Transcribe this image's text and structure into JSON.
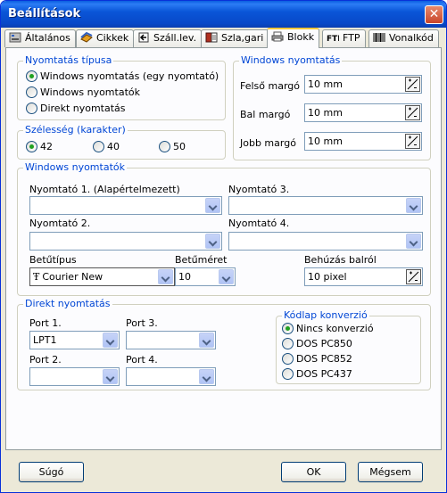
{
  "window": {
    "title": "Beállítások",
    "close_glyph": "✕"
  },
  "tabs": [
    {
      "label": "Általános",
      "icon": "settings-icon",
      "active": false
    },
    {
      "label": "Cikkek",
      "icon": "items-icon",
      "active": false
    },
    {
      "label": "Száll.lev.",
      "icon": "delivery-note-icon",
      "active": false
    },
    {
      "label": "Szla,gari",
      "icon": "invoice-icon",
      "active": false
    },
    {
      "label": "Blokk",
      "icon": "printer-icon",
      "active": true
    },
    {
      "label": "FTP",
      "icon": "ftp-icon",
      "active": false
    },
    {
      "label": "Vonalkód",
      "icon": "barcode-icon",
      "active": false
    }
  ],
  "print_type": {
    "legend": "Nyomtatás típusa",
    "options": [
      "Windows nyomtatás (egy nyomtató)",
      "Windows nyomtatók",
      "Direkt nyomtatás"
    ],
    "selected": 0
  },
  "width": {
    "legend": "Szélesség (karakter)",
    "options": [
      "42",
      "40",
      "50"
    ],
    "selected": 0
  },
  "windows_print": {
    "legend": "Windows nyomtatás",
    "fields": [
      {
        "label": "Felső margó",
        "value": "10 mm"
      },
      {
        "label": "Bal margó",
        "value": "10 mm"
      },
      {
        "label": "Jobb margó",
        "value": "10 mm"
      }
    ]
  },
  "windows_printers": {
    "legend": "Windows nyomtatók",
    "printer1_label": "Nyomtató 1. (Alapértelmezett)",
    "printer2_label": "Nyomtató 2.",
    "printer3_label": "Nyomtató 3.",
    "printer4_label": "Nyomtató 4.",
    "font_label": "Betűtípus",
    "font_value": "Courier New",
    "font_icon_glyph": "Ŧ",
    "fontsize_label": "Betűméret",
    "fontsize_value": "10",
    "indent_label": "Behúzás balról",
    "indent_value": "10 pixel"
  },
  "direct_print": {
    "legend": "Direkt nyomtatás",
    "port1_label": "Port 1.",
    "port1_value": "LPT1",
    "port2_label": "Port 2.",
    "port3_label": "Port 3.",
    "port4_label": "Port 4."
  },
  "codepage": {
    "legend": "Kódlap konverzió",
    "options": [
      "Nincs konverzió",
      "DOS PC850",
      "DOS PC852",
      "DOS PC437"
    ],
    "selected": 0
  },
  "buttons": {
    "help": "Súgó",
    "ok": "OK",
    "cancel": "Mégsem"
  }
}
